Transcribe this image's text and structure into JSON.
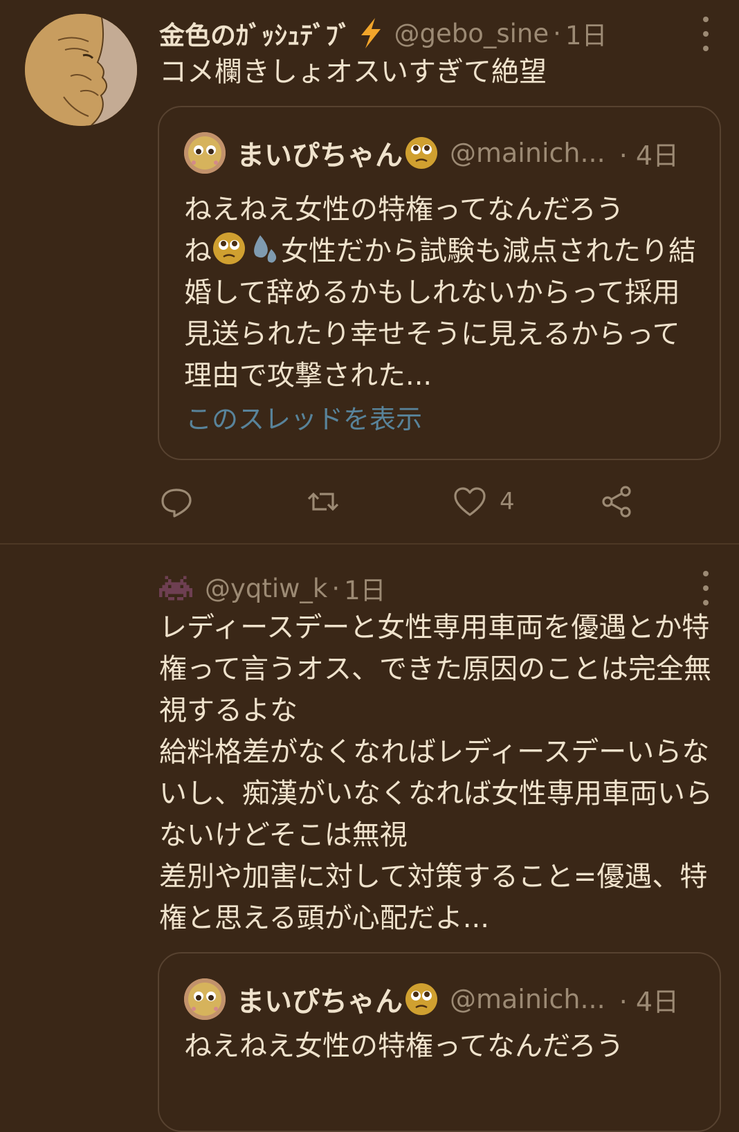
{
  "tweet1": {
    "author_name": "金色のｶﾞｯｼｭﾃﾞﾌﾞ",
    "handle": "@gebo_sine",
    "separator": "·",
    "time": "1日",
    "text": "コメ欄きしょオスいすぎて絶望",
    "quote": {
      "name": "まいぴちゃん",
      "handle": "@mainich...",
      "separator": "·",
      "time": "4日",
      "text_part1": "ねえねえ女性の特権ってなんだろう",
      "text_part2": "ね",
      "text_part3": "女性だから試験も減点されたり結婚して辞めるかもしれないからって採用見送られたり幸せそうに見えるからって理由で攻撃された...",
      "show_thread": "このスレッドを表示"
    },
    "actions": {
      "like_count": "4"
    }
  },
  "tweet2": {
    "handle": "@yqtiw_k",
    "separator": "·",
    "time": "1日",
    "text": "レディースデーと女性専用車両を優遇とか特権って言うオス、できた原因のことは完全無視するよな\n給料格差がなくなればレディースデーいらないし、痴漢がいなくなれば女性専用車両いらないけどそこは無視\n差別や加害に対して対策すること=優遇、特権と思える頭が心配だよ...",
    "quote": {
      "name": "まいぴちゃん",
      "handle": "@mainich...",
      "separator": "·",
      "time": "4日",
      "text": "ねえねえ女性の特権ってなんだろう"
    }
  },
  "colors": {
    "background": "#3a2717",
    "text": "#efe2cc",
    "muted": "#9c8a74",
    "link": "#58839a",
    "border": "#574230"
  },
  "icons": [
    "more-icon",
    "bolt-emoji",
    "pleading-face-emoji",
    "sweat-droplets-emoji",
    "reply-icon",
    "retweet-icon",
    "like-icon",
    "share-icon",
    "space-invader-icon"
  ]
}
